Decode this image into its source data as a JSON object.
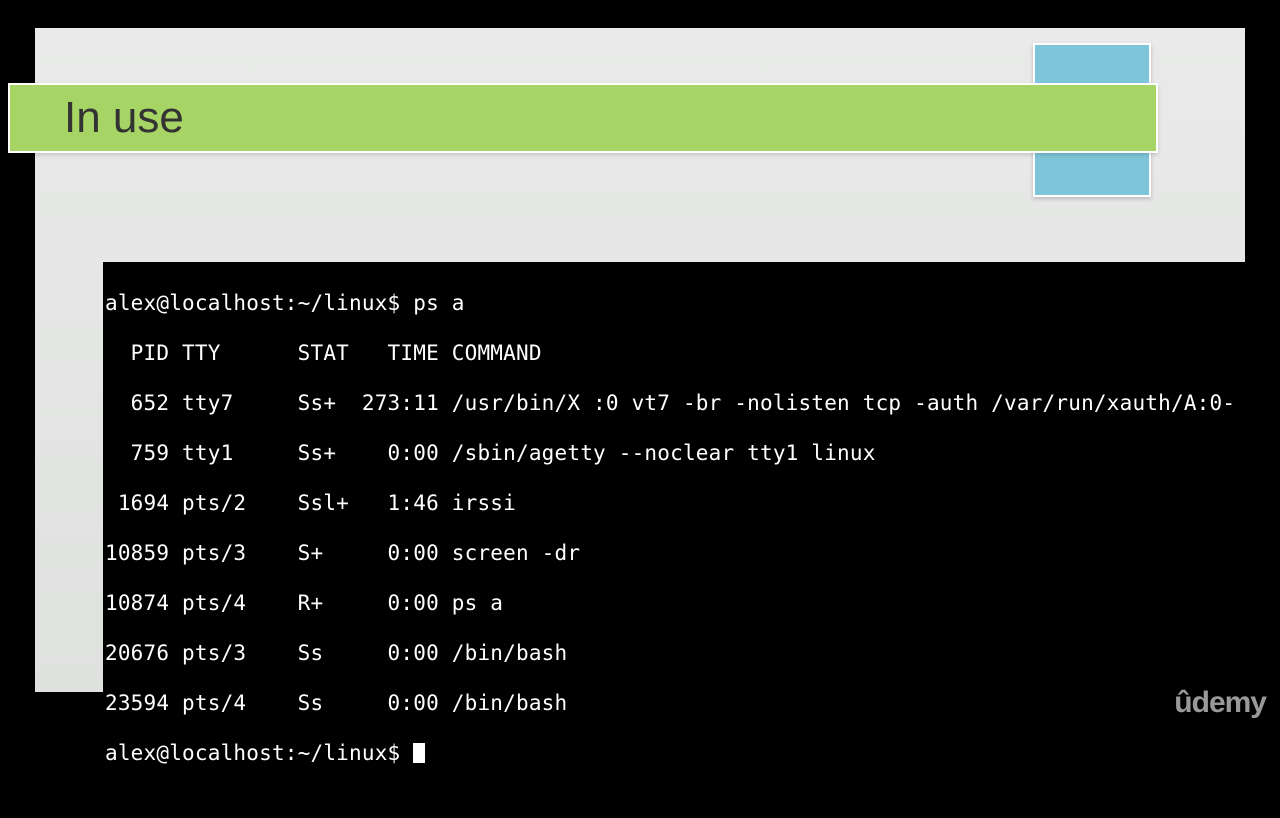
{
  "slide": {
    "title": "In use"
  },
  "terminal": {
    "prompt": "alex@localhost:~/linux$",
    "command": "ps a",
    "header": "  PID TTY      STAT   TIME COMMAND",
    "rows": [
      {
        "pid": "652",
        "tty": "tty7",
        "stat": "Ss+",
        "time": "273:11",
        "cmd": "/usr/bin/X :0 vt7 -br -nolisten tcp -auth /var/run/xauth/A:0-"
      },
      {
        "pid": "759",
        "tty": "tty1",
        "stat": "Ss+",
        "time": "0:00",
        "cmd": "/sbin/agetty --noclear tty1 linux"
      },
      {
        "pid": "1694",
        "tty": "pts/2",
        "stat": "Ssl+",
        "time": "1:46",
        "cmd": "irssi"
      },
      {
        "pid": "10859",
        "tty": "pts/3",
        "stat": "S+",
        "time": "0:00",
        "cmd": "screen -dr"
      },
      {
        "pid": "10874",
        "tty": "pts/4",
        "stat": "R+",
        "time": "0:00",
        "cmd": "ps a"
      },
      {
        "pid": "20676",
        "tty": "pts/3",
        "stat": "Ss",
        "time": "0:00",
        "cmd": "/bin/bash"
      },
      {
        "pid": "23594",
        "tty": "pts/4",
        "stat": "Ss",
        "time": "0:00",
        "cmd": "/bin/bash"
      }
    ],
    "prompt2": "alex@localhost:~/linux$"
  },
  "watermark": "ûdemy"
}
